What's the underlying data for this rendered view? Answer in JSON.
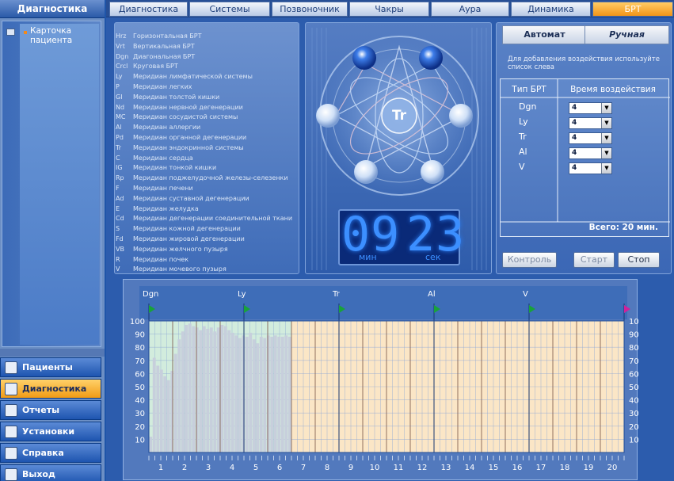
{
  "sidebar": {
    "title": "Диагностика",
    "tree_item": "Карточка пациента",
    "nav": [
      {
        "label": "Пациенты",
        "icon": "patients-icon",
        "active": false
      },
      {
        "label": "Диагностика",
        "icon": "diagnostics-icon",
        "active": true
      },
      {
        "label": "Отчеты",
        "icon": "reports-icon",
        "active": false
      },
      {
        "label": "Установки",
        "icon": "settings-icon",
        "active": false
      },
      {
        "label": "Справка",
        "icon": "help-icon",
        "active": false
      },
      {
        "label": "Выход",
        "icon": "exit-icon",
        "active": false
      }
    ]
  },
  "tabs": [
    "Диагностика",
    "Системы",
    "Позвоночник",
    "Чакры",
    "Аура",
    "Динамика",
    "БРТ"
  ],
  "active_tab": "БРТ",
  "brt_list": [
    {
      "abbr": "Hrz",
      "name": "Горизонтальная БРТ"
    },
    {
      "abbr": "Vrt",
      "name": "Вертикальная БРТ"
    },
    {
      "abbr": "Dgn",
      "name": "Диагональная БРТ"
    },
    {
      "abbr": "Crcl",
      "name": "Круговая БРТ"
    },
    {
      "abbr": "Ly",
      "name": "Меридиан лимфатической системы"
    },
    {
      "abbr": "P",
      "name": "Меридиан легких"
    },
    {
      "abbr": "GI",
      "name": "Меридиан толстой кишки"
    },
    {
      "abbr": "Nd",
      "name": "Меридиан нервной дегенерации"
    },
    {
      "abbr": "MC",
      "name": "Меридиан сосудистой системы"
    },
    {
      "abbr": "Al",
      "name": "Меридиан аллергии"
    },
    {
      "abbr": "Pd",
      "name": "Меридиан органной дегенерации"
    },
    {
      "abbr": "Tr",
      "name": "Меридиан эндокринной системы"
    },
    {
      "abbr": "C",
      "name": "Меридиан сердца"
    },
    {
      "abbr": "IG",
      "name": "Меридиан тонкой кишки"
    },
    {
      "abbr": "Rp",
      "name": "Меридиан поджелудочной железы-селезенки"
    },
    {
      "abbr": "F",
      "name": "Меридиан печени"
    },
    {
      "abbr": "Ad",
      "name": "Меридиан суставной дегенерации"
    },
    {
      "abbr": "E",
      "name": "Меридиан желудка"
    },
    {
      "abbr": "Cd",
      "name": "Меридиан дегенерации соединительной ткани"
    },
    {
      "abbr": "S",
      "name": "Меридиан кожной дегенерации"
    },
    {
      "abbr": "Fd",
      "name": "Меридиан жировой дегенерации"
    },
    {
      "abbr": "VB",
      "name": "Меридиан желчного пузыря"
    },
    {
      "abbr": "R",
      "name": "Меридиан почек"
    },
    {
      "abbr": "V",
      "name": "Меридиан мочевого пузыря"
    }
  ],
  "center": {
    "label": "Tr"
  },
  "timer": {
    "minutes": "09",
    "seconds": "23",
    "min_label": "мин",
    "sec_label": "сек"
  },
  "mode": {
    "auto": "Автомат",
    "manual": "Ручная"
  },
  "hint": "Для добавления воздействия используйте список слева",
  "table": {
    "col_type": "Тип БРТ",
    "col_time": "Время воздействия",
    "rows": [
      {
        "type": "Dgn",
        "time": "4"
      },
      {
        "type": "Ly",
        "time": "4"
      },
      {
        "type": "Tr",
        "time": "4"
      },
      {
        "type": "Al",
        "time": "4"
      },
      {
        "type": "V",
        "time": "4"
      }
    ],
    "total": "Всего: 20 мин."
  },
  "buttons": {
    "control": "Контроль",
    "start": "Старт",
    "stop": "Стоп"
  },
  "colors": {
    "accent": "#f29418",
    "timer_digits": "#3c8fff",
    "plot_bg_done": "#d2ecdd",
    "plot_bg_pending": "#fbe6c6",
    "bar": "#c7cfdc"
  },
  "chart_data": {
    "type": "bar",
    "xlim": [
      0,
      20
    ],
    "ylim": [
      0,
      100
    ],
    "yticks": [
      10,
      20,
      30,
      40,
      50,
      60,
      70,
      80,
      90,
      100
    ],
    "xticks": [
      "1",
      "2",
      "3",
      "4",
      "5",
      "6",
      "7",
      "8",
      "9",
      "10",
      "11",
      "12",
      "13",
      "14",
      "15",
      "16",
      "17",
      "18",
      "19",
      "20"
    ],
    "segments": [
      {
        "label": "Dgn",
        "start": 0
      },
      {
        "label": "Ly",
        "start": 4
      },
      {
        "label": "Tr",
        "start": 8
      },
      {
        "label": "Al",
        "start": 12
      },
      {
        "label": "V",
        "start": 16
      }
    ],
    "elapsed_minutes": 6,
    "values": [
      12,
      72,
      66,
      63,
      58,
      55,
      62,
      75,
      86,
      92,
      97,
      98,
      96,
      95,
      93,
      96,
      94,
      95,
      92,
      95,
      97,
      96,
      93,
      91,
      89,
      87,
      89,
      88,
      91,
      86,
      83,
      88,
      87,
      89,
      88,
      89,
      88,
      88,
      89,
      88
    ]
  }
}
